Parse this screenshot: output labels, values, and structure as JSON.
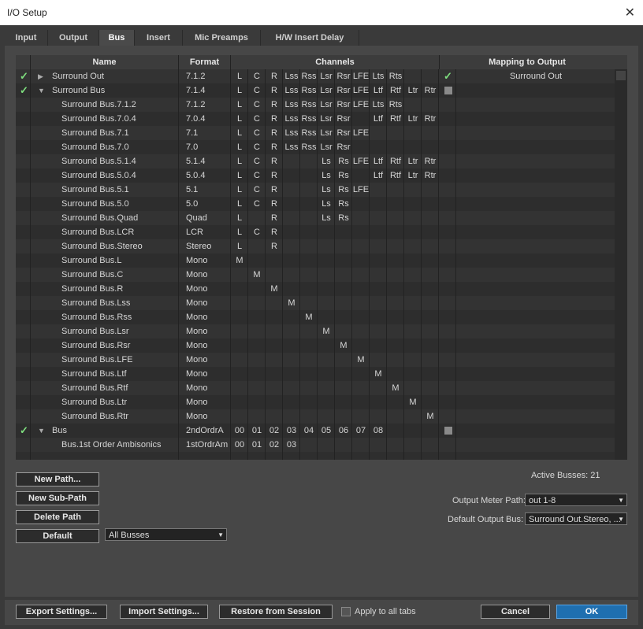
{
  "window": {
    "title": "I/O Setup"
  },
  "tabs": [
    {
      "label": "Input"
    },
    {
      "label": "Output"
    },
    {
      "label": "Bus"
    },
    {
      "label": "Insert"
    },
    {
      "label": "Mic Preamps"
    },
    {
      "label": "H/W Insert Delay"
    }
  ],
  "table": {
    "headers": {
      "name": "Name",
      "format": "Format",
      "channels": "Channels",
      "mapping": "Mapping to Output"
    },
    "rows": [
      {
        "check": true,
        "expand": "▶",
        "name": "Surround Out",
        "format": "7.1.2",
        "ch": [
          "L",
          "C",
          "R",
          "Lss",
          "Rss",
          "Lsr",
          "Rsr",
          "LFE",
          "Lts",
          "Rts",
          "",
          ""
        ],
        "map": "check",
        "mapping": "Surround Out"
      },
      {
        "check": true,
        "expand": "▼",
        "name": "Surround Bus",
        "format": "7.1.4",
        "ch": [
          "L",
          "C",
          "R",
          "Lss",
          "Rss",
          "Lsr",
          "Rsr",
          "LFE",
          "Ltf",
          "Rtf",
          "Ltr",
          "Rtr"
        ],
        "map": "square",
        "mapping": ""
      },
      {
        "check": false,
        "expand": "",
        "name": "Surround Bus.7.1.2",
        "format": "7.1.2",
        "ch": [
          "L",
          "C",
          "R",
          "Lss",
          "Rss",
          "Lsr",
          "Rsr",
          "LFE",
          "Lts",
          "Rts",
          "",
          ""
        ],
        "map": "",
        "mapping": ""
      },
      {
        "check": false,
        "expand": "",
        "name": "Surround Bus.7.0.4",
        "format": "7.0.4",
        "ch": [
          "L",
          "C",
          "R",
          "Lss",
          "Rss",
          "Lsr",
          "Rsr",
          "",
          "Ltf",
          "Rtf",
          "Ltr",
          "Rtr"
        ],
        "map": "",
        "mapping": ""
      },
      {
        "check": false,
        "expand": "",
        "name": "Surround Bus.7.1",
        "format": "7.1",
        "ch": [
          "L",
          "C",
          "R",
          "Lss",
          "Rss",
          "Lsr",
          "Rsr",
          "LFE",
          "",
          "",
          "",
          ""
        ],
        "map": "",
        "mapping": ""
      },
      {
        "check": false,
        "expand": "",
        "name": "Surround Bus.7.0",
        "format": "7.0",
        "ch": [
          "L",
          "C",
          "R",
          "Lss",
          "Rss",
          "Lsr",
          "Rsr",
          "",
          "",
          "",
          "",
          ""
        ],
        "map": "",
        "mapping": ""
      },
      {
        "check": false,
        "expand": "",
        "name": "Surround Bus.5.1.4",
        "format": "5.1.4",
        "ch": [
          "L",
          "C",
          "R",
          "",
          "",
          "Ls",
          "Rs",
          "LFE",
          "Ltf",
          "Rtf",
          "Ltr",
          "Rtr"
        ],
        "map": "",
        "mapping": ""
      },
      {
        "check": false,
        "expand": "",
        "name": "Surround Bus.5.0.4",
        "format": "5.0.4",
        "ch": [
          "L",
          "C",
          "R",
          "",
          "",
          "Ls",
          "Rs",
          "",
          "Ltf",
          "Rtf",
          "Ltr",
          "Rtr"
        ],
        "map": "",
        "mapping": ""
      },
      {
        "check": false,
        "expand": "",
        "name": "Surround Bus.5.1",
        "format": "5.1",
        "ch": [
          "L",
          "C",
          "R",
          "",
          "",
          "Ls",
          "Rs",
          "LFE",
          "",
          "",
          "",
          ""
        ],
        "map": "",
        "mapping": ""
      },
      {
        "check": false,
        "expand": "",
        "name": "Surround Bus.5.0",
        "format": "5.0",
        "ch": [
          "L",
          "C",
          "R",
          "",
          "",
          "Ls",
          "Rs",
          "",
          "",
          "",
          "",
          ""
        ],
        "map": "",
        "mapping": ""
      },
      {
        "check": false,
        "expand": "",
        "name": "Surround Bus.Quad",
        "format": "Quad",
        "ch": [
          "L",
          "",
          "R",
          "",
          "",
          "Ls",
          "Rs",
          "",
          "",
          "",
          "",
          ""
        ],
        "map": "",
        "mapping": ""
      },
      {
        "check": false,
        "expand": "",
        "name": "Surround Bus.LCR",
        "format": "LCR",
        "ch": [
          "L",
          "C",
          "R",
          "",
          "",
          "",
          "",
          "",
          "",
          "",
          "",
          ""
        ],
        "map": "",
        "mapping": ""
      },
      {
        "check": false,
        "expand": "",
        "name": "Surround Bus.Stereo",
        "format": "Stereo",
        "ch": [
          "L",
          "",
          "R",
          "",
          "",
          "",
          "",
          "",
          "",
          "",
          "",
          ""
        ],
        "map": "",
        "mapping": ""
      },
      {
        "check": false,
        "expand": "",
        "name": "Surround Bus.L",
        "format": "Mono",
        "ch": [
          "M",
          "",
          "",
          "",
          "",
          "",
          "",
          "",
          "",
          "",
          "",
          ""
        ],
        "map": "",
        "mapping": ""
      },
      {
        "check": false,
        "expand": "",
        "name": "Surround Bus.C",
        "format": "Mono",
        "ch": [
          "",
          "M",
          "",
          "",
          "",
          "",
          "",
          "",
          "",
          "",
          "",
          ""
        ],
        "map": "",
        "mapping": ""
      },
      {
        "check": false,
        "expand": "",
        "name": "Surround Bus.R",
        "format": "Mono",
        "ch": [
          "",
          "",
          "M",
          "",
          "",
          "",
          "",
          "",
          "",
          "",
          "",
          ""
        ],
        "map": "",
        "mapping": ""
      },
      {
        "check": false,
        "expand": "",
        "name": "Surround Bus.Lss",
        "format": "Mono",
        "ch": [
          "",
          "",
          "",
          "M",
          "",
          "",
          "",
          "",
          "",
          "",
          "",
          ""
        ],
        "map": "",
        "mapping": ""
      },
      {
        "check": false,
        "expand": "",
        "name": "Surround Bus.Rss",
        "format": "Mono",
        "ch": [
          "",
          "",
          "",
          "",
          "M",
          "",
          "",
          "",
          "",
          "",
          "",
          ""
        ],
        "map": "",
        "mapping": ""
      },
      {
        "check": false,
        "expand": "",
        "name": "Surround Bus.Lsr",
        "format": "Mono",
        "ch": [
          "",
          "",
          "",
          "",
          "",
          "M",
          "",
          "",
          "",
          "",
          "",
          ""
        ],
        "map": "",
        "mapping": ""
      },
      {
        "check": false,
        "expand": "",
        "name": "Surround Bus.Rsr",
        "format": "Mono",
        "ch": [
          "",
          "",
          "",
          "",
          "",
          "",
          "M",
          "",
          "",
          "",
          "",
          ""
        ],
        "map": "",
        "mapping": ""
      },
      {
        "check": false,
        "expand": "",
        "name": "Surround Bus.LFE",
        "format": "Mono",
        "ch": [
          "",
          "",
          "",
          "",
          "",
          "",
          "",
          "M",
          "",
          "",
          "",
          ""
        ],
        "map": "",
        "mapping": ""
      },
      {
        "check": false,
        "expand": "",
        "name": "Surround Bus.Ltf",
        "format": "Mono",
        "ch": [
          "",
          "",
          "",
          "",
          "",
          "",
          "",
          "",
          "M",
          "",
          "",
          ""
        ],
        "map": "",
        "mapping": ""
      },
      {
        "check": false,
        "expand": "",
        "name": "Surround Bus.Rtf",
        "format": "Mono",
        "ch": [
          "",
          "",
          "",
          "",
          "",
          "",
          "",
          "",
          "",
          "M",
          "",
          ""
        ],
        "map": "",
        "mapping": ""
      },
      {
        "check": false,
        "expand": "",
        "name": "Surround Bus.Ltr",
        "format": "Mono",
        "ch": [
          "",
          "",
          "",
          "",
          "",
          "",
          "",
          "",
          "",
          "",
          "M",
          ""
        ],
        "map": "",
        "mapping": ""
      },
      {
        "check": false,
        "expand": "",
        "name": "Surround Bus.Rtr",
        "format": "Mono",
        "ch": [
          "",
          "",
          "",
          "",
          "",
          "",
          "",
          "",
          "",
          "",
          "",
          "M"
        ],
        "map": "",
        "mapping": ""
      },
      {
        "check": true,
        "expand": "▼",
        "name": "Bus",
        "format": "2ndOrdrA",
        "ch": [
          "00",
          "01",
          "02",
          "03",
          "04",
          "05",
          "06",
          "07",
          "08",
          "",
          "",
          ""
        ],
        "map": "square",
        "mapping": ""
      },
      {
        "check": false,
        "expand": "",
        "name": "Bus.1st Order Ambisonics",
        "format": "1stOrdrAm",
        "ch": [
          "00",
          "01",
          "02",
          "03",
          "",
          "",
          "",
          "",
          "",
          "",
          "",
          ""
        ],
        "map": "",
        "mapping": ""
      }
    ]
  },
  "buttons": {
    "new_path": "New Path...",
    "new_sub_path": "New Sub-Path",
    "delete_path": "Delete Path",
    "default": "Default",
    "export": "Export Settings...",
    "import": "Import Settings...",
    "restore": "Restore from Session",
    "cancel": "Cancel",
    "ok": "OK"
  },
  "filter": {
    "value": "All Busses"
  },
  "active_busses": "Active Busses: 21",
  "output_meter": {
    "label": "Output Meter Path:",
    "value": "out 1-8"
  },
  "default_output": {
    "label": "Default Output Bus:",
    "value": "Surround Out.Stereo, ..."
  },
  "apply_all_tabs": "Apply to all tabs",
  "colors": {
    "check": "#7fe07f",
    "ok_button": "#1f6fb0"
  }
}
